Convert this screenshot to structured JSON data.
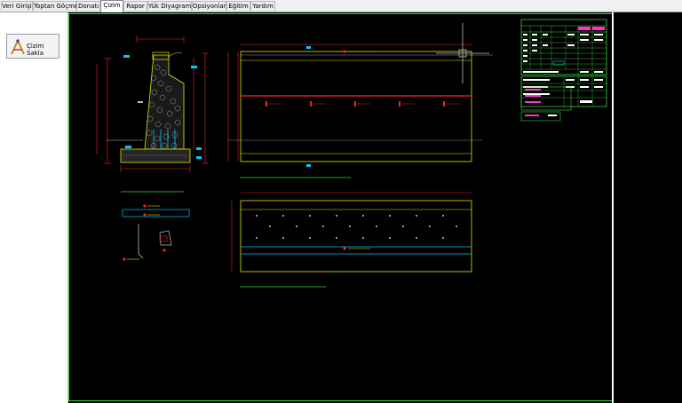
{
  "tabs": [
    {
      "label": "Veri Girişi",
      "active": false
    },
    {
      "label": "Toptan Göçme",
      "active": false
    },
    {
      "label": "Donatı",
      "active": false
    },
    {
      "label": "Çizim",
      "active": true
    },
    {
      "label": "Rapor",
      "active": false
    },
    {
      "label": "Yük Diyagramı",
      "active": false
    },
    {
      "label": "Opsiyonlar",
      "active": false
    },
    {
      "label": "Eğitim",
      "active": false
    },
    {
      "label": "Yardım",
      "active": false
    }
  ],
  "sidebar": {
    "save_label": "Çizim Sakla"
  },
  "colors": {
    "frame": "#39d439",
    "yellow": "#e6e600",
    "red": "#ff2020",
    "cyan": "#00c8ff",
    "white": "#ffffff",
    "magenta": "#ff33cc"
  }
}
